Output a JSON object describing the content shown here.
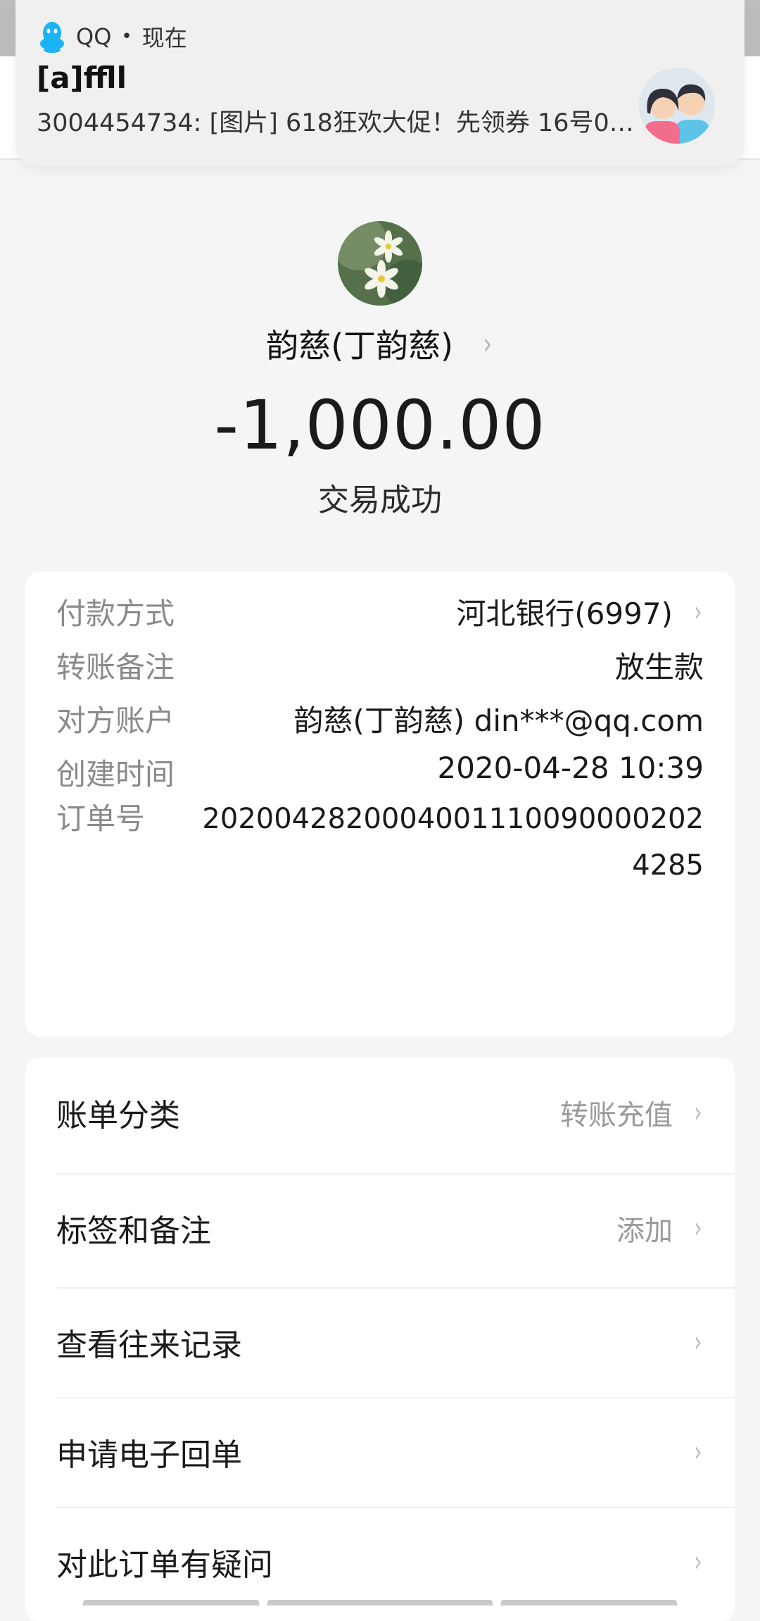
{
  "notification": {
    "app_name": "QQ",
    "separator": "•",
    "time": "现在",
    "title": "[a]ffll",
    "text": "3004454734: [图片] 618狂欢大促！先领券 16号0…",
    "app_icon": "qq-penguin-icon",
    "avatar_icon": "couple-avatar"
  },
  "transaction": {
    "payee_name": "韵慈(丁韵慈)",
    "amount": "-1,000.00",
    "status": "交易成功"
  },
  "details": [
    {
      "label": "付款方式",
      "value": "河北银行(6997)",
      "has_chevron": true
    },
    {
      "label": "转账备注",
      "value": "放生款"
    },
    {
      "label": "对方账户",
      "value": "韵慈(丁韵慈) din***@qq.com"
    },
    {
      "label": "创建时间",
      "value": "2020-04-28 10:39"
    },
    {
      "label": "订单号",
      "value": "20200428200040011100900002024285"
    }
  ],
  "menu": [
    {
      "label": "账单分类",
      "hint": "转账充值"
    },
    {
      "label": "标签和备注",
      "hint": "添加"
    },
    {
      "label": "查看往来记录",
      "hint": ""
    },
    {
      "label": "申请电子回单",
      "hint": ""
    },
    {
      "label": "对此订单有疑问",
      "hint": ""
    }
  ],
  "chevron_glyph": "›",
  "colors": {
    "background": "#f5f5f5",
    "card": "#ffffff",
    "label_gray": "#8a8a8a",
    "text": "#1a1a1a",
    "qq_blue": "#1ab3f5"
  }
}
